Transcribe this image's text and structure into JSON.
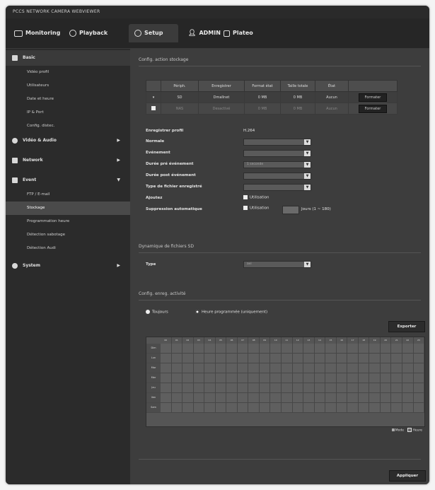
{
  "window_title": "PCCS NETWORK CAMERA WEBVIEWER",
  "topnav": {
    "monitoring": "Monitoring",
    "playback": "Playback",
    "setup": "Setup",
    "user": "ADMIN",
    "about": "Plateo"
  },
  "sidebar": {
    "basic": "Basic",
    "basic_items": [
      "Vidéo profil",
      "Utilisateurs",
      "Date et heure",
      "IP & Port",
      "Config. distec."
    ],
    "video_audio": "Vidéo & Audio",
    "network": "Network",
    "event": "Event",
    "event_items": [
      "FTP / E-mail",
      "Stockage",
      "Programmation heure",
      "Détection sabotage",
      "Détection Audi"
    ],
    "system": "System"
  },
  "main": {
    "section1_title": "Config. action stockage",
    "table": {
      "headers": [
        "Périph.",
        "Enregistrer",
        "Format état",
        "Taille totale",
        "État",
        ""
      ],
      "rows": [
        [
          "SD",
          "Dmallnet",
          "0 MB",
          "0 MB",
          "Aucun",
          "Formater"
        ],
        [
          "NAS",
          "Desactivé",
          "0 MB",
          "0 MB",
          "Aucun",
          "Formater"
        ]
      ]
    },
    "fields": {
      "profile_label": "Enregistrer profil",
      "profile_value": "H.264",
      "normal_label": "Normale",
      "event_label": "Evénement",
      "pre_event_label": "Durée pré événement",
      "pre_event_value": "1 seconde",
      "post_event_label": "Durée post événement",
      "file_type_label": "Type de fichier enregistré",
      "overwrite_label": "Ajoutez",
      "overwrite_value": "Utilisation",
      "auto_delete_label": "Suppression automatique",
      "auto_delete_value": "Utilisation",
      "auto_delete_unit": "Jours (1 ~ 180)"
    },
    "section2_title": "Dynamique de fichiers SD",
    "type_label": "Type",
    "type_value": "avi",
    "section3_title": "Config. enreg. activité",
    "radio_always": "Toujours",
    "radio_schedule": "Heure programmée (uniquement)",
    "export_button": "Exporter",
    "days": [
      "Dim",
      "Lun",
      "Mar",
      "Mer",
      "Jeu",
      "Ven",
      "Sam"
    ],
    "hours": [
      "00",
      "01",
      "02",
      "03",
      "04",
      "05",
      "06",
      "07",
      "08",
      "09",
      "10",
      "11",
      "12",
      "13",
      "14",
      "15",
      "16",
      "17",
      "18",
      "19",
      "20",
      "21",
      "22",
      "23"
    ],
    "legend_mode": "Mode",
    "legend_hours": "Heure",
    "apply_button": "Appliquer"
  }
}
